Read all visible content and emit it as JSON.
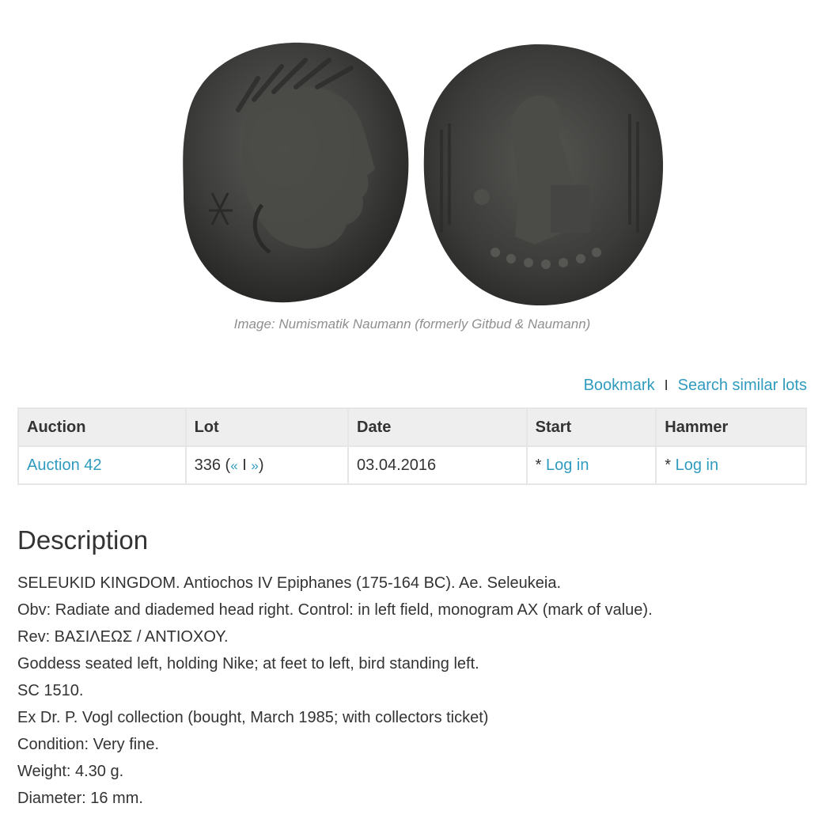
{
  "image_caption": "Image: Numismatik Naumann (formerly Gitbud & Naumann)",
  "actions": {
    "bookmark": "Bookmark",
    "separator": "I",
    "search_similar": "Search similar lots"
  },
  "table": {
    "headers": [
      "Auction",
      "Lot",
      "Date",
      "Start",
      "Hammer"
    ],
    "row": {
      "auction": "Auction 42",
      "lot_number": "336",
      "prev": "«",
      "sep": "I",
      "next": "»",
      "date": "03.04.2016",
      "start_prefix": "* ",
      "start_link": "Log in",
      "hammer_prefix": "* ",
      "hammer_link": "Log in"
    }
  },
  "description": {
    "title": "Description",
    "lines": [
      "SELEUKID KINGDOM. Antiochos IV Epiphanes (175-164 BC). Ae. Seleukeia.",
      "Obv: Radiate and diademed head right. Control: in left field, monogram AX (mark of value).",
      "Rev: ΒΑΣΙΛΕΩΣ / ΑΝΤΙΟΧΟΥ.",
      "Goddess seated left, holding Nike; at feet to left, bird standing left.",
      "SC 1510.",
      "Ex Dr. P. Vogl collection (bought, March 1985; with collectors ticket)",
      "Condition: Very fine.",
      "Weight: 4.30 g.",
      "Diameter: 16 mm."
    ]
  }
}
